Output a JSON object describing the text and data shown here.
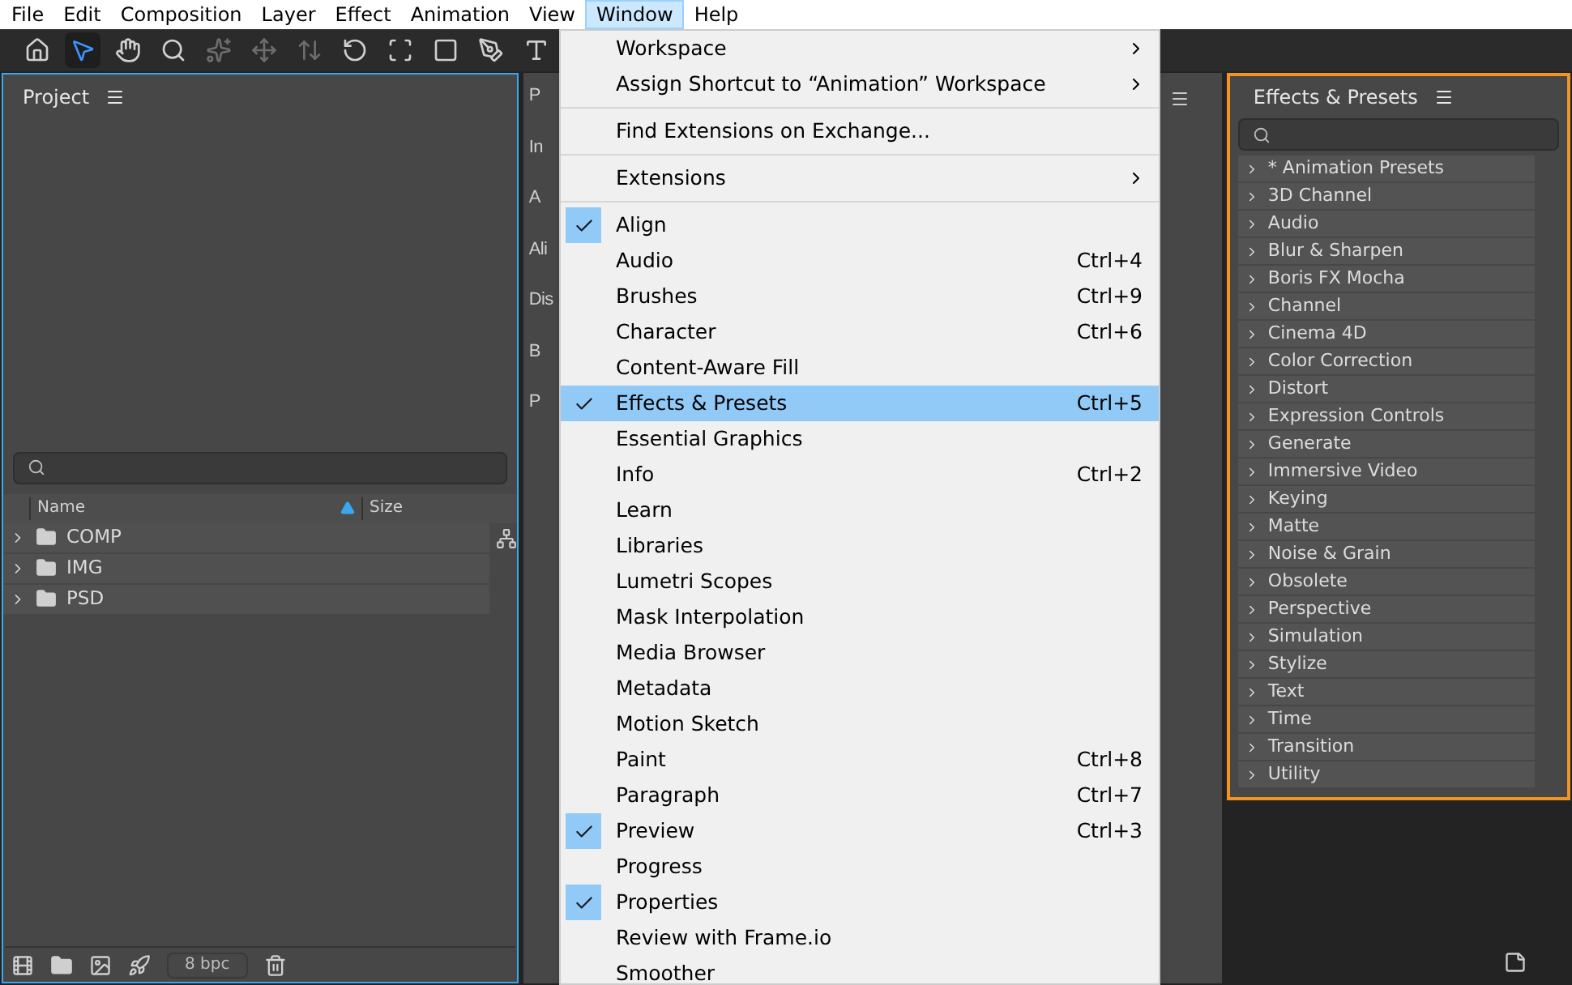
{
  "menubar": [
    {
      "label": "File",
      "selected": false
    },
    {
      "label": "Edit",
      "selected": false
    },
    {
      "label": "Composition",
      "selected": false
    },
    {
      "label": "Layer",
      "selected": false
    },
    {
      "label": "Effect",
      "selected": false
    },
    {
      "label": "Animation",
      "selected": false
    },
    {
      "label": "View",
      "selected": false
    },
    {
      "label": "Window",
      "selected": true
    },
    {
      "label": "Help",
      "selected": false
    }
  ],
  "tools": [
    {
      "selected": false,
      "disabled": false
    },
    {
      "selected": true,
      "disabled": false
    },
    {
      "selected": false,
      "disabled": false
    },
    {
      "selected": false,
      "disabled": false
    },
    {
      "selected": false,
      "disabled": true
    },
    {
      "selected": false,
      "disabled": true
    },
    {
      "selected": false,
      "disabled": true
    },
    {
      "selected": false,
      "disabled": false
    },
    {
      "selected": false,
      "disabled": false
    },
    {
      "selected": false,
      "disabled": false
    },
    {
      "selected": false,
      "disabled": false
    },
    {
      "selected": false,
      "disabled": false
    }
  ],
  "project": {
    "title": "Project",
    "columns": [
      {
        "label": "Name",
        "sorted": true
      },
      {
        "label": "Size",
        "sorted": false
      }
    ],
    "rows": [
      {
        "name": "COMP",
        "expanded": false
      },
      {
        "name": "IMG",
        "expanded": false
      },
      {
        "name": "PSD",
        "expanded": false
      }
    ],
    "bit_depth": "8 bpc"
  },
  "middle_panel": {
    "labels": [
      "P",
      "In",
      "A",
      "Ali",
      "Dis",
      "B",
      "P"
    ]
  },
  "window_menu": {
    "groups": [
      [
        {
          "kind": "submenu",
          "label": "Workspace"
        },
        {
          "kind": "submenu",
          "label": "Assign Shortcut to “Animation” Workspace"
        }
      ],
      [
        {
          "kind": "item",
          "label": "Find Extensions on Exchange..."
        }
      ],
      [
        {
          "kind": "submenu",
          "label": "Extensions"
        }
      ],
      [
        {
          "kind": "item",
          "label": "Align",
          "checked": true,
          "selected": false
        },
        {
          "kind": "item",
          "label": "Audio",
          "shortcut": "Ctrl+4",
          "checked": false,
          "selected": false
        },
        {
          "kind": "item",
          "label": "Brushes",
          "shortcut": "Ctrl+9",
          "checked": false,
          "selected": false
        },
        {
          "kind": "item",
          "label": "Character",
          "shortcut": "Ctrl+6",
          "checked": false,
          "selected": false
        },
        {
          "kind": "item",
          "label": "Content-Aware Fill",
          "checked": false,
          "selected": false
        },
        {
          "kind": "item",
          "label": "Effects & Presets",
          "shortcut": "Ctrl+5",
          "checked": true,
          "selected": true
        },
        {
          "kind": "item",
          "label": "Essential Graphics",
          "checked": false,
          "selected": false
        },
        {
          "kind": "item",
          "label": "Info",
          "shortcut": "Ctrl+2",
          "checked": false,
          "selected": false
        },
        {
          "kind": "item",
          "label": "Learn",
          "checked": false,
          "selected": false
        },
        {
          "kind": "item",
          "label": "Libraries",
          "checked": false,
          "selected": false
        },
        {
          "kind": "item",
          "label": "Lumetri Scopes",
          "checked": false,
          "selected": false
        },
        {
          "kind": "item",
          "label": "Mask Interpolation",
          "checked": false,
          "selected": false
        },
        {
          "kind": "item",
          "label": "Media Browser",
          "checked": false,
          "selected": false
        },
        {
          "kind": "item",
          "label": "Metadata",
          "checked": false,
          "selected": false
        },
        {
          "kind": "item",
          "label": "Motion Sketch",
          "checked": false,
          "selected": false
        },
        {
          "kind": "item",
          "label": "Paint",
          "shortcut": "Ctrl+8",
          "checked": false,
          "selected": false
        },
        {
          "kind": "item",
          "label": "Paragraph",
          "shortcut": "Ctrl+7",
          "checked": false,
          "selected": false
        },
        {
          "kind": "item",
          "label": "Preview",
          "shortcut": "Ctrl+3",
          "checked": true,
          "selected": false
        },
        {
          "kind": "item",
          "label": "Progress",
          "checked": false,
          "selected": false
        },
        {
          "kind": "item",
          "label": "Properties",
          "checked": true,
          "selected": false
        },
        {
          "kind": "item",
          "label": "Review with Frame.io",
          "checked": false,
          "selected": false
        },
        {
          "kind": "item",
          "label": "Smoother",
          "checked": false,
          "selected": false
        }
      ]
    ]
  },
  "effects": {
    "title": "Effects & Presets",
    "items": [
      {
        "label": "* Animation Presets"
      },
      {
        "label": "3D Channel"
      },
      {
        "label": "Audio"
      },
      {
        "label": "Blur & Sharpen"
      },
      {
        "label": "Boris FX Mocha"
      },
      {
        "label": "Channel"
      },
      {
        "label": "Cinema 4D"
      },
      {
        "label": "Color Correction"
      },
      {
        "label": "Distort"
      },
      {
        "label": "Expression Controls"
      },
      {
        "label": "Generate"
      },
      {
        "label": "Immersive Video"
      },
      {
        "label": "Keying"
      },
      {
        "label": "Matte"
      },
      {
        "label": "Noise & Grain"
      },
      {
        "label": "Obsolete"
      },
      {
        "label": "Perspective"
      },
      {
        "label": "Simulation"
      },
      {
        "label": "Stylize"
      },
      {
        "label": "Text"
      },
      {
        "label": "Time"
      },
      {
        "label": "Transition"
      },
      {
        "label": "Utility"
      }
    ]
  }
}
